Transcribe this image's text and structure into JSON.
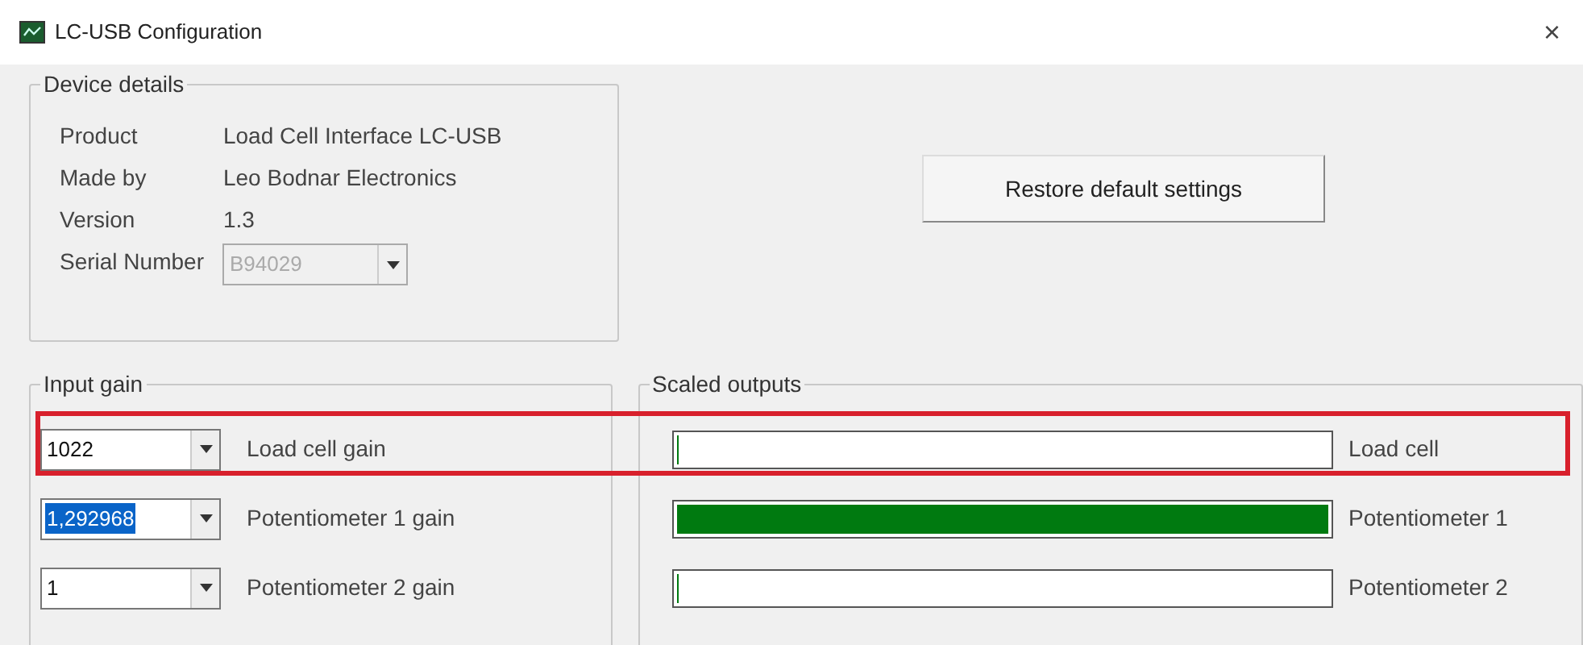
{
  "window": {
    "title": "LC-USB Configuration",
    "close": "×"
  },
  "device_details": {
    "title": "Device details",
    "fields": [
      {
        "label": "Product",
        "value": "Load Cell Interface LC-USB",
        "kind": "text"
      },
      {
        "label": "Made by",
        "value": "Leo Bodnar Electronics",
        "kind": "text"
      },
      {
        "label": "Version",
        "value": "1.3",
        "kind": "text"
      },
      {
        "label": "Serial Number",
        "value": "B94029",
        "kind": "combo",
        "disabled": true
      }
    ]
  },
  "restore_button": "Restore default settings",
  "input_gain": {
    "title": "Input gain",
    "rows": [
      {
        "value": "1022",
        "label": "Load cell gain",
        "selected": false,
        "highlighted": true
      },
      {
        "value": "1,292968",
        "label": "Potentiometer 1 gain",
        "selected": true,
        "highlighted": false
      },
      {
        "value": "1",
        "label": "Potentiometer 2 gain",
        "selected": false,
        "highlighted": false
      }
    ]
  },
  "scaled_outputs": {
    "title": "Scaled outputs",
    "rows": [
      {
        "label": "Load cell",
        "level": 0.003
      },
      {
        "label": "Potentiometer 1",
        "level": 1
      },
      {
        "label": "Potentiometer 2",
        "level": 0.003
      }
    ]
  }
}
